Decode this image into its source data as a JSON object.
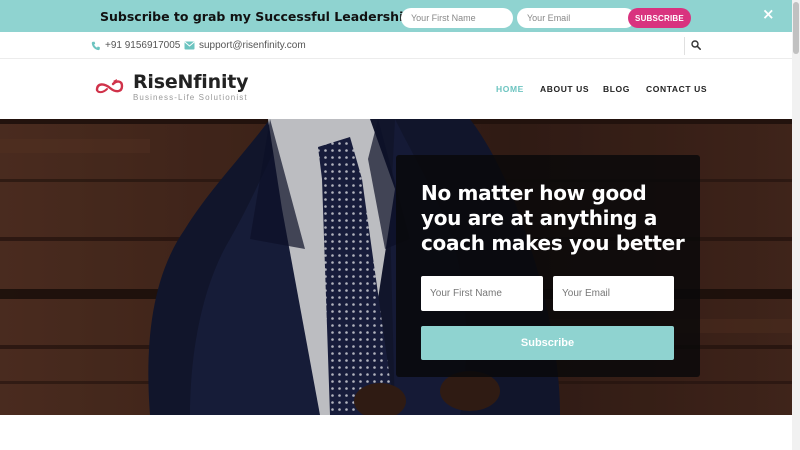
{
  "promo": {
    "title": "Subscribe to grab my Successful Leadership eBook",
    "first_name_placeholder": "Your First Name",
    "email_placeholder": "Your Email",
    "button_label": "SUBSCRIBE",
    "close_icon": "×"
  },
  "contact": {
    "phone": "+91 9156917005",
    "email": "support@risenfinity.com",
    "phone_icon": "phone-icon",
    "mail_icon": "envelope-icon",
    "search_icon": "search-icon"
  },
  "nav": {
    "logo_name": "RiseNfinity",
    "logo_tagline": "Business-Life Solutionist",
    "items": [
      {
        "label": "HOME"
      },
      {
        "label": "ABOUT US"
      },
      {
        "label": "BLOG"
      },
      {
        "label": "CONTACT US"
      }
    ]
  },
  "hero": {
    "headline": "No matter how good you are at anything a coach makes you better",
    "first_name_placeholder": "Your First Name",
    "email_placeholder": "Your Email",
    "button_label": "Subscribe"
  },
  "colors": {
    "accent": "#8fd3d0",
    "brand_pink": "#d9337f",
    "hero_card": "#0b0b0d"
  }
}
